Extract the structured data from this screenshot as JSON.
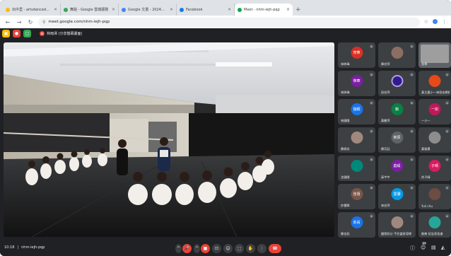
{
  "browser": {
    "tabs": [
      {
        "label": "出中里 - artsdancedeluxe.com",
        "fav": "#fbbc04",
        "active": false
      },
      {
        "label": "舞蹈 - Google 雲端硬碟",
        "fav": "#34a853",
        "active": false
      },
      {
        "label": "Google 文書 - 2024學年",
        "fav": "#4285f4",
        "active": false
      },
      {
        "label": "Facebook",
        "fav": "#1877f2",
        "active": false
      },
      {
        "label": "Meet - nhm-iejh-pqp",
        "fav": "#00ac47",
        "active": true
      }
    ],
    "new_tab": "+",
    "back": "←",
    "forward": "→",
    "reload": "↻",
    "url": "meet.google.com/nhm-iejh-pqp",
    "lock": "⚲",
    "star": "☆",
    "menu": "⋮"
  },
  "meet_header": {
    "presenter_label": "林雨澤 (分享螢幕畫面)",
    "presenter_initial": "林"
  },
  "participants": [
    {
      "name": "林映瑋",
      "avatar_text": "育華",
      "color": "#d93025"
    },
    {
      "name": "陳芸萍",
      "avatar_text": "",
      "color": "#8d6e63"
    },
    {
      "name": "兆學",
      "avatar_text": "",
      "color": "#5f6368"
    },
    {
      "name": "林映瑋",
      "avatar_text": "惟華",
      "color": "#7b1fa2"
    },
    {
      "name": "段芸萍",
      "avatar_text": "",
      "color": "#311b92"
    },
    {
      "name": "黃芷嘉小一林思宏媽媽",
      "avatar_text": "",
      "color": "#e64a19"
    },
    {
      "name": "林國隆",
      "avatar_text": "伽穎",
      "color": "#1a73e8"
    },
    {
      "name": "黃艷萍",
      "avatar_text": "鍋",
      "color": "#0b8043"
    },
    {
      "name": "一小一",
      "avatar_text": "一如",
      "color": "#c2185b"
    },
    {
      "name": "陳佩玟",
      "avatar_text": "",
      "color": "#a1887f"
    },
    {
      "name": "陳芳廷",
      "avatar_text": "奕辰",
      "color": "#5f6368"
    },
    {
      "name": "黃雅惠",
      "avatar_text": "",
      "color": "#8d8d8d"
    },
    {
      "name": "沈國陽",
      "avatar_text": "",
      "color": "#00897b"
    },
    {
      "name": "高芊芊",
      "avatar_text": "庭緹",
      "color": "#7b1fa2"
    },
    {
      "name": "徐子晴",
      "avatar_text": "子晴",
      "color": "#d81b60"
    },
    {
      "name": "許櫻華",
      "avatar_text": "佳禧",
      "color": "#795548"
    },
    {
      "name": "林芸萍",
      "avatar_text": "雲瀾",
      "color": "#039be5"
    },
    {
      "name": "Yuli chu",
      "avatar_text": "",
      "color": "#6d4c41"
    },
    {
      "name": "陳金鈺",
      "avatar_text": "俞員",
      "color": "#1a73e8"
    },
    {
      "name": "國際扣分 不住當班導師",
      "avatar_text": "",
      "color": "#a1887f"
    },
    {
      "name": "劉慈 紀念家長會",
      "avatar_text": "",
      "color": "#26a69a"
    }
  ],
  "toolbar": {
    "time": "10:18",
    "meeting_code": "nhm-iejh-pqp",
    "mic_icon": "🎤",
    "cam_icon": "■",
    "cc_icon": "⊡",
    "emoji_icon": "☺",
    "present_icon": "⬚",
    "hand_icon": "✋",
    "more_icon": "⋮",
    "leave_icon": "☎",
    "info_icon": "ⓘ",
    "people_icon": "☺",
    "chat_icon": "▤",
    "activities_icon": "◭",
    "people_count": "23"
  }
}
